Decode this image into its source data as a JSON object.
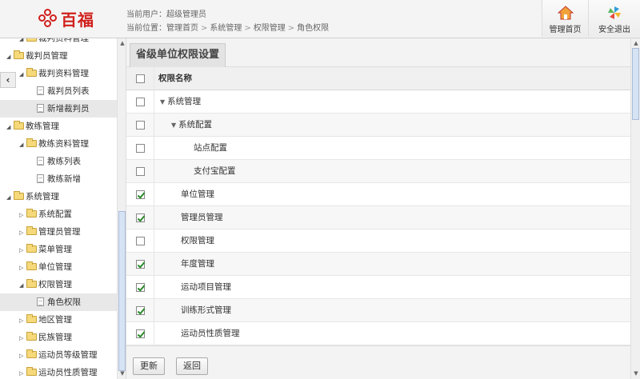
{
  "header": {
    "logo_text": "百福",
    "current_user_label": "当前用户：",
    "current_user": "超级管理员",
    "location_label": "当前位置：",
    "breadcrumb": [
      "管理首页",
      "系统管理",
      "权限管理",
      "角色权限"
    ],
    "home_button": "管理首页",
    "logout_button": "安全退出",
    "colors": {
      "brand": "#d0201c"
    }
  },
  "sidebar": {
    "collapse_icon": "‹",
    "items": [
      {
        "label": "裁判资料管理",
        "level": 1,
        "type": "folder",
        "expanded": true
      },
      {
        "label": "裁判员管理",
        "level": 0,
        "type": "folder",
        "expanded": true
      },
      {
        "label": "裁判资料管理",
        "level": 1,
        "type": "folder",
        "expanded": true
      },
      {
        "label": "裁判员列表",
        "level": 2,
        "type": "doc"
      },
      {
        "label": "新增裁判员",
        "level": 2,
        "type": "doc",
        "selected": true
      },
      {
        "label": "教练管理",
        "level": 0,
        "type": "folder",
        "expanded": true
      },
      {
        "label": "教练资料管理",
        "level": 1,
        "type": "folder",
        "expanded": true
      },
      {
        "label": "教练列表",
        "level": 2,
        "type": "doc"
      },
      {
        "label": "教练新增",
        "level": 2,
        "type": "doc"
      },
      {
        "label": "系统管理",
        "level": 0,
        "type": "folder",
        "expanded": true
      },
      {
        "label": "系统配置",
        "level": 1,
        "type": "folder",
        "expanded": false
      },
      {
        "label": "管理员管理",
        "level": 1,
        "type": "folder",
        "expanded": false
      },
      {
        "label": "菜单管理",
        "level": 1,
        "type": "folder",
        "expanded": false
      },
      {
        "label": "单位管理",
        "level": 1,
        "type": "folder",
        "expanded": false
      },
      {
        "label": "权限管理",
        "level": 1,
        "type": "folder",
        "expanded": true
      },
      {
        "label": "角色权限",
        "level": 2,
        "type": "doc",
        "selected": true
      },
      {
        "label": "地区管理",
        "level": 1,
        "type": "folder",
        "expanded": false
      },
      {
        "label": "民族管理",
        "level": 1,
        "type": "folder",
        "expanded": false
      },
      {
        "label": "运动员等级管理",
        "level": 1,
        "type": "folder",
        "expanded": false
      },
      {
        "label": "运动员性质管理",
        "level": 1,
        "type": "folder",
        "expanded": false
      }
    ]
  },
  "main": {
    "tab_title": "省级单位权限设置",
    "table": {
      "header": "权限名称",
      "rows": [
        {
          "label": "系统管理",
          "level": 0,
          "checked": false,
          "has_children": true
        },
        {
          "label": "系统配置",
          "level": 1,
          "checked": false,
          "has_children": true
        },
        {
          "label": "站点配置",
          "level": 2,
          "checked": false
        },
        {
          "label": "支付宝配置",
          "level": 2,
          "checked": false
        },
        {
          "label": "单位管理",
          "level": 1,
          "checked": true
        },
        {
          "label": "管理员管理",
          "level": 1,
          "checked": true
        },
        {
          "label": "权限管理",
          "level": 1,
          "checked": false
        },
        {
          "label": "年度管理",
          "level": 1,
          "checked": true
        },
        {
          "label": "运动项目管理",
          "level": 1,
          "checked": true
        },
        {
          "label": "训练形式管理",
          "level": 1,
          "checked": true
        },
        {
          "label": "运动员性质管理",
          "level": 1,
          "checked": true
        }
      ]
    },
    "update_button": "更新",
    "back_button": "返回"
  }
}
